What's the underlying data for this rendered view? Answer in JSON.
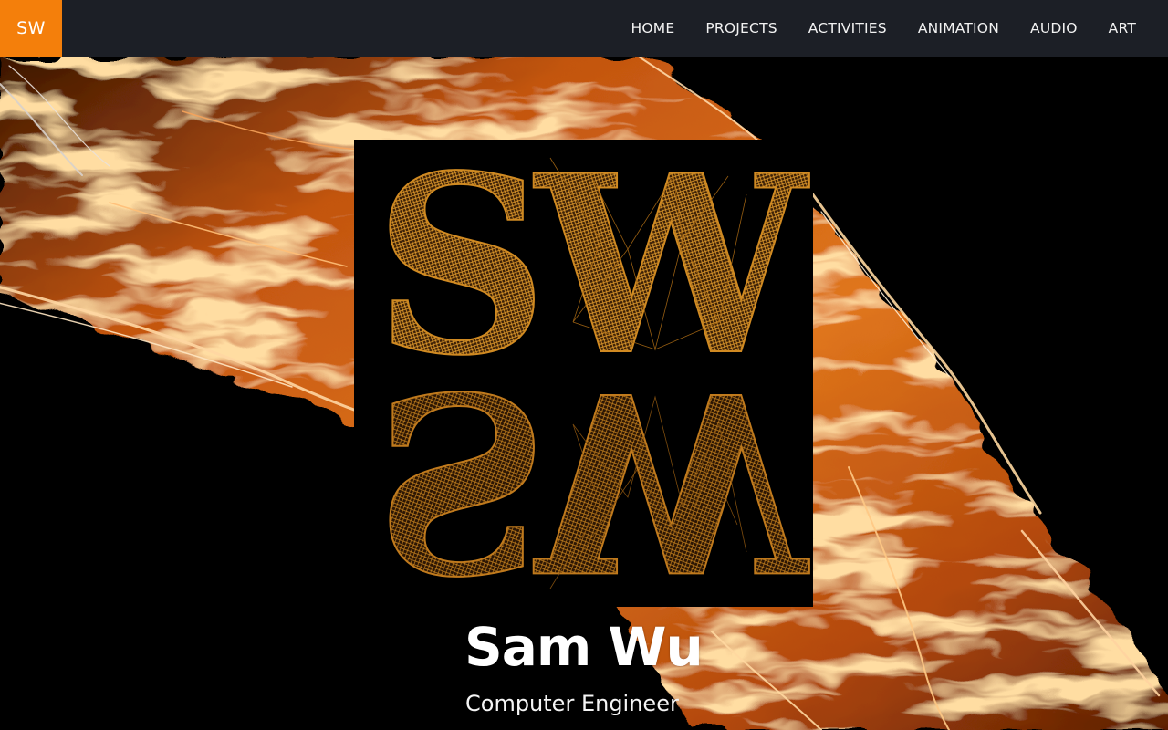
{
  "navbar": {
    "brand": "SW",
    "brand_color": "#f47f0b",
    "background_color": "#1c1f26",
    "links": [
      {
        "label": "HOME"
      },
      {
        "label": "PROJECTS"
      },
      {
        "label": "ACTIVITIES"
      },
      {
        "label": "ANIMATION"
      },
      {
        "label": "AUDIO"
      },
      {
        "label": "ART"
      }
    ]
  },
  "hero": {
    "background": "fire-flames-image",
    "logo": {
      "text_top": "SW",
      "text_bottom_mirrored": "SW",
      "color": "#c98422"
    },
    "name": "Sam Wu",
    "role": "Computer Engineer"
  }
}
